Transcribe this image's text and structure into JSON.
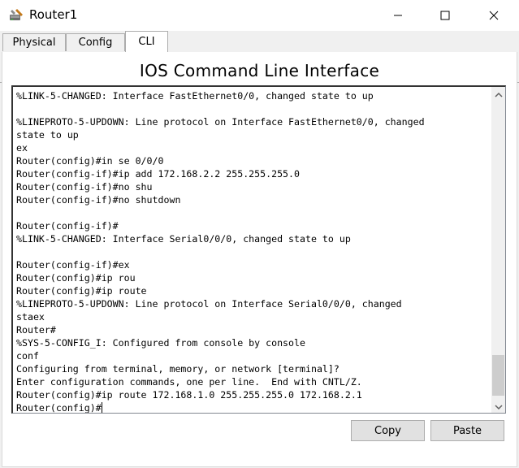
{
  "window": {
    "title": "Router1",
    "app_icon": "router-tools-icon",
    "controls": [
      "minimize-icon",
      "maximize-icon",
      "close-icon"
    ]
  },
  "tabs": [
    {
      "label": "Physical",
      "active": false
    },
    {
      "label": "Config",
      "active": false
    },
    {
      "label": "CLI",
      "active": true
    }
  ],
  "cli": {
    "heading": "IOS Command Line Interface",
    "terminal_text": "%LINK-5-CHANGED: Interface FastEthernet0/0, changed state to up\n\n%LINEPROTO-5-UPDOWN: Line protocol on Interface FastEthernet0/0, changed\nstate to up\nex\nRouter(config)#in se 0/0/0\nRouter(config-if)#ip add 172.168.2.2 255.255.255.0\nRouter(config-if)#no shu\nRouter(config-if)#no shutdown\n\nRouter(config-if)#\n%LINK-5-CHANGED: Interface Serial0/0/0, changed state to up\n\nRouter(config-if)#ex\nRouter(config)#ip rou\nRouter(config)#ip route\n%LINEPROTO-5-UPDOWN: Line protocol on Interface Serial0/0/0, changed\nstaex\nRouter#\n%SYS-5-CONFIG_I: Configured from console by console\nconf\nConfiguring from terminal, memory, or network [terminal]?\nEnter configuration commands, one per line.  End with CNTL/Z.\nRouter(config)#ip route 172.168.1.0 255.255.255.0 172.168.2.1\nRouter(config)#",
    "copy_label": "Copy",
    "paste_label": "Paste"
  }
}
